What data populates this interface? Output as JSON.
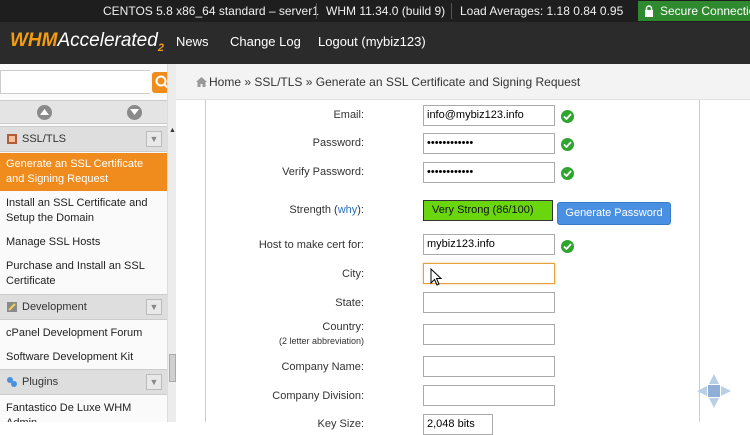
{
  "topbar": {
    "os": "CENTOS 5.8 x86_64 standard – server1",
    "whm": "WHM 11.34.0 (build 9)",
    "load": "Load Averages: 1.18 0.84 0.95",
    "secure": "Secure Connection"
  },
  "nav": {
    "logo_main": "WHM",
    "logo_acc": "Accelerated",
    "logo_sub": "2",
    "links": [
      "News",
      "Change Log",
      "Logout (mybiz123)"
    ]
  },
  "sidebar": {
    "search_placeholder": "",
    "sections": {
      "ssl": "SSL/TLS",
      "development": "Development",
      "plugins": "Plugins"
    },
    "ssl_items": [
      "Generate an SSL Certificate and Signing Request",
      "Install an SSL Certificate and Setup the Domain",
      "Manage SSL Hosts",
      "Purchase and Install an SSL Certificate"
    ],
    "dev_items": [
      "cPanel Development Forum",
      "Software Development Kit"
    ],
    "plugin_items": [
      "Fantastico De Luxe WHM Admin"
    ]
  },
  "breadcrumb": {
    "home": "Home",
    "sep": "»",
    "section": "SSL/TLS",
    "page": "Generate an SSL Certificate and Signing Request"
  },
  "form": {
    "email_label": "Email:",
    "email_value": "info@mybiz123.info",
    "password_label": "Password:",
    "password_value": "••••••••••••",
    "verify_label": "Verify Password:",
    "verify_value": "••••••••••••",
    "strength_label": "Strength (",
    "strength_why": "why",
    "strength_close": "):",
    "strength_value": "Very Strong (86/100)",
    "generate_button": "Generate Password",
    "host_label": "Host to make cert for:",
    "host_value": "mybiz123.info",
    "city_label": "City:",
    "city_value": "",
    "state_label": "State:",
    "state_value": "",
    "country_label": "Country:",
    "country_hint": "(2 letter abbreviation)",
    "country_value": "",
    "company_label": "Company Name:",
    "company_value": "",
    "division_label": "Company Division:",
    "division_value": "",
    "keysize_label": "Key Size:",
    "keysize_value": "2,048 bits"
  },
  "colors": {
    "accent": "#f08c1e",
    "strength_bar": "#6ad60e",
    "button": "#4a90e2",
    "check": "#2ea52e"
  }
}
